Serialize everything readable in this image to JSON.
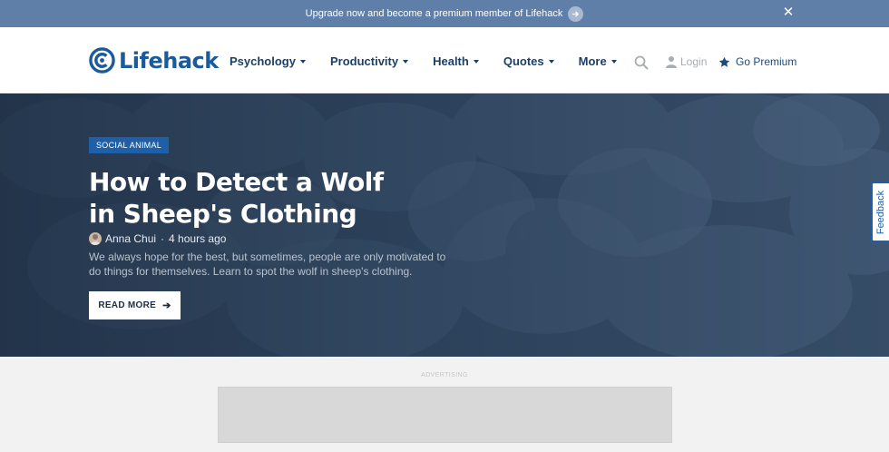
{
  "promo": {
    "text": "Upgrade now and become a premium member of Lifehack",
    "arrow_icon": "arrow-right-icon",
    "close_icon": "close-icon"
  },
  "header": {
    "logo_text": "Lifehack",
    "brand_color": "#1b5a9b",
    "nav": [
      {
        "label": "Psychology"
      },
      {
        "label": "Productivity"
      },
      {
        "label": "Health"
      },
      {
        "label": "Quotes"
      },
      {
        "label": "More"
      }
    ],
    "search_icon": "search-icon",
    "login_label": "Login",
    "premium_label": "Go Premium"
  },
  "hero": {
    "tag": "SOCIAL ANIMAL",
    "title": "How to Detect a Wolf in Sheep's Clothing",
    "author": "Anna Chui",
    "time": "4 hours ago",
    "excerpt": "We always hope for the best, but sometimes, people are only motivated to do things for themselves. Learn to spot the wolf in sheep's clothing.",
    "cta": "READ MORE"
  },
  "feedback_label": "Feedback",
  "ad": {
    "label": "ADVERTISING"
  }
}
